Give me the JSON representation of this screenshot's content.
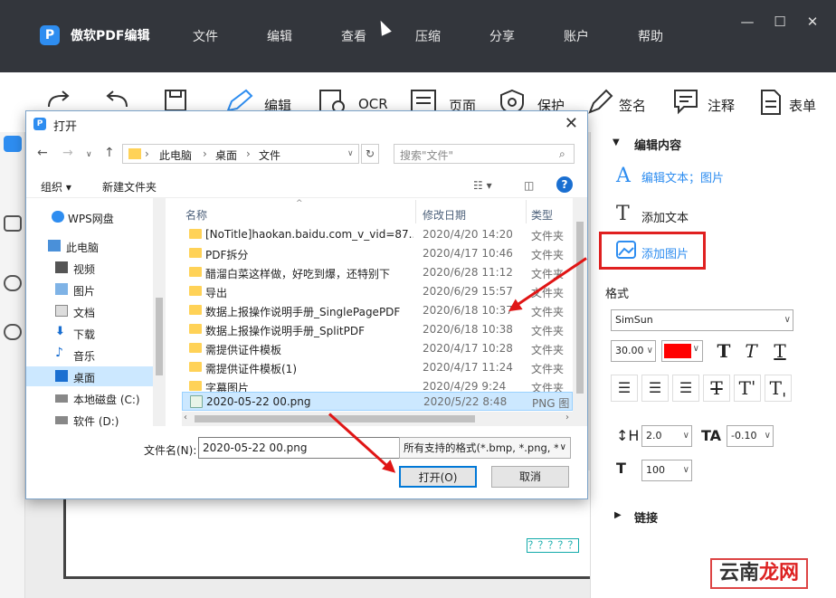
{
  "app": {
    "name": "傲软PDF编辑",
    "menu": [
      "文件",
      "编辑",
      "查看",
      "压缩",
      "分享",
      "账户",
      "帮助"
    ]
  },
  "toolbar": {
    "tools": [
      "编辑",
      "OCR",
      "页面",
      "保护",
      "签名",
      "注释",
      "表单"
    ]
  },
  "right_panel": {
    "edit_section": "编辑内容",
    "edit_text_image": "编辑文本；图片",
    "add_text": "添加文本",
    "add_image": "添加图片",
    "format_label": "格式",
    "font": "SimSun",
    "font_size": "30.00",
    "line_spacing": "2.0",
    "char_spacing": "-0.10",
    "scale": "100",
    "link_section": "链接",
    "text_color": "#ff0000"
  },
  "document": {
    "tag_text": "？？？？？"
  },
  "watermark": {
    "text_a": "云南",
    "text_b": "龙网"
  },
  "dialog": {
    "title": "打开",
    "breadcrumb": [
      "此电脑",
      "桌面",
      "文件"
    ],
    "search_placeholder": "搜索\"文件\"",
    "organize": "组织",
    "new_folder": "新建文件夹",
    "nav_items": [
      {
        "label": "WPS网盘"
      },
      {
        "label": "此电脑"
      },
      {
        "label": "视频"
      },
      {
        "label": "图片"
      },
      {
        "label": "文档"
      },
      {
        "label": "下载"
      },
      {
        "label": "音乐"
      },
      {
        "label": "桌面"
      },
      {
        "label": "本地磁盘 (C:)"
      },
      {
        "label": "软件 (D:)"
      }
    ],
    "columns": {
      "name": "名称",
      "date": "修改日期",
      "type": "类型"
    },
    "files": [
      {
        "name": "[NoTitle]haokan.baidu.com_v_vid=87...",
        "date": "2020/4/20 14:20",
        "type": "文件夹"
      },
      {
        "name": "PDF拆分",
        "date": "2020/4/17 10:46",
        "type": "文件夹"
      },
      {
        "name": "醋溜白菜这样做，好吃到爆，还特别下",
        "date": "2020/6/28 11:12",
        "type": "文件夹"
      },
      {
        "name": "导出",
        "date": "2020/6/29 15:57",
        "type": "文件夹"
      },
      {
        "name": "数据上报操作说明手册_SinglePagePDF",
        "date": "2020/6/18 10:37",
        "type": "文件夹"
      },
      {
        "name": "数据上报操作说明手册_SplitPDF",
        "date": "2020/6/18 10:38",
        "type": "文件夹"
      },
      {
        "name": "需提供证件模板",
        "date": "2020/4/17 10:28",
        "type": "文件夹"
      },
      {
        "name": "需提供证件模板(1)",
        "date": "2020/4/17 11:24",
        "type": "文件夹"
      },
      {
        "name": "字幕图片",
        "date": "2020/4/29 9:24",
        "type": "文件夹"
      },
      {
        "name": "2020-05-22 00.png",
        "date": "2020/5/22 8:48",
        "type": "PNG 图"
      }
    ],
    "filename_label": "文件名(N):",
    "filename_value": "2020-05-22 00.png",
    "filter": "所有支持的格式(*.bmp, *.png, *",
    "open_button": "打开(O)",
    "cancel_button": "取消"
  }
}
